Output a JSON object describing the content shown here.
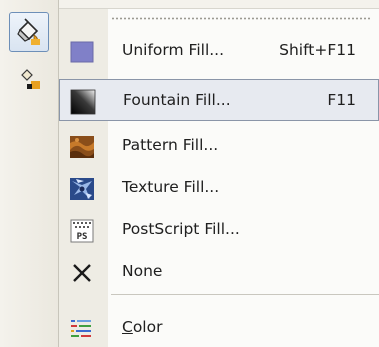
{
  "toolbox": {
    "active_tool_icon": "fill-bucket-icon",
    "secondary_tool_icon": "interactive-fill-icon"
  },
  "menu": {
    "items": [
      {
        "label": "Uniform Fill...",
        "shortcut": "Shift+F11",
        "icon": "uniform-fill-icon"
      },
      {
        "label": "Fountain Fill...",
        "shortcut": "F11",
        "icon": "fountain-fill-icon"
      },
      {
        "label": "Pattern Fill...",
        "shortcut": "",
        "icon": "pattern-fill-icon"
      },
      {
        "label": "Texture Fill...",
        "shortcut": "",
        "icon": "texture-fill-icon"
      },
      {
        "label": "PostScript Fill...",
        "shortcut": "",
        "icon": "postscript-fill-icon"
      },
      {
        "label": "None",
        "shortcut": "",
        "icon": "no-fill-icon"
      }
    ],
    "color_item": {
      "mnemonic": "C",
      "rest": "olor",
      "icon": "color-docker-icon"
    },
    "icon_text": {
      "postscript": "PS"
    },
    "highlighted_item": "Fountain Fill...",
    "colors": {
      "uniform_fill": "#8080c8",
      "highlight_bg": "#e7eaf0",
      "highlight_border": "#8a95a8",
      "gutter": "#eeece4"
    }
  }
}
